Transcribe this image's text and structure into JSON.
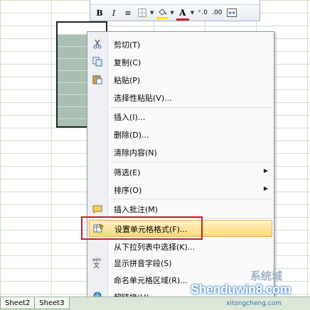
{
  "mini_toolbar": {
    "bold": "B",
    "italic": "I",
    "align": "≡",
    "font_color": "A",
    "inc_decimal": "⁺.0",
    "dec_decimal": ".00",
    "fill_color": "#ffe000",
    "text_color": "#d0202a"
  },
  "menu": {
    "items": [
      {
        "label": "剪切(T)",
        "icon": "scissors-icon"
      },
      {
        "label": "复制(C)",
        "icon": "copy-icon"
      },
      {
        "label": "粘贴(P)",
        "icon": "paste-icon"
      },
      {
        "label": "选择性粘贴(V)..."
      },
      {
        "label": "插入(I)..."
      },
      {
        "label": "删除(D)..."
      },
      {
        "label": "清除内容(N)"
      },
      {
        "label": "筛选(E)",
        "submenu": true
      },
      {
        "label": "排序(O)",
        "submenu": true
      },
      {
        "label": "插入批注(M)",
        "icon": "comment-icon"
      },
      {
        "label": "设置单元格格式(F)...",
        "icon": "format-cells-icon",
        "highlighted": true
      },
      {
        "label": "从下拉列表中选择(K)..."
      },
      {
        "label": "显示拼音字段(S)",
        "icon": "phonetic-icon"
      },
      {
        "label": "命名单元格区域(R)..."
      },
      {
        "label": "超链接(H)...",
        "icon": "hyperlink-icon"
      }
    ],
    "submenu_arrow": "▶"
  },
  "tabs": [
    "Sheet2",
    "Sheet3"
  ],
  "watermark": {
    "logo": "Shenduwin8.com",
    "site": "xitongcheng.com",
    "cn": "系统城"
  }
}
